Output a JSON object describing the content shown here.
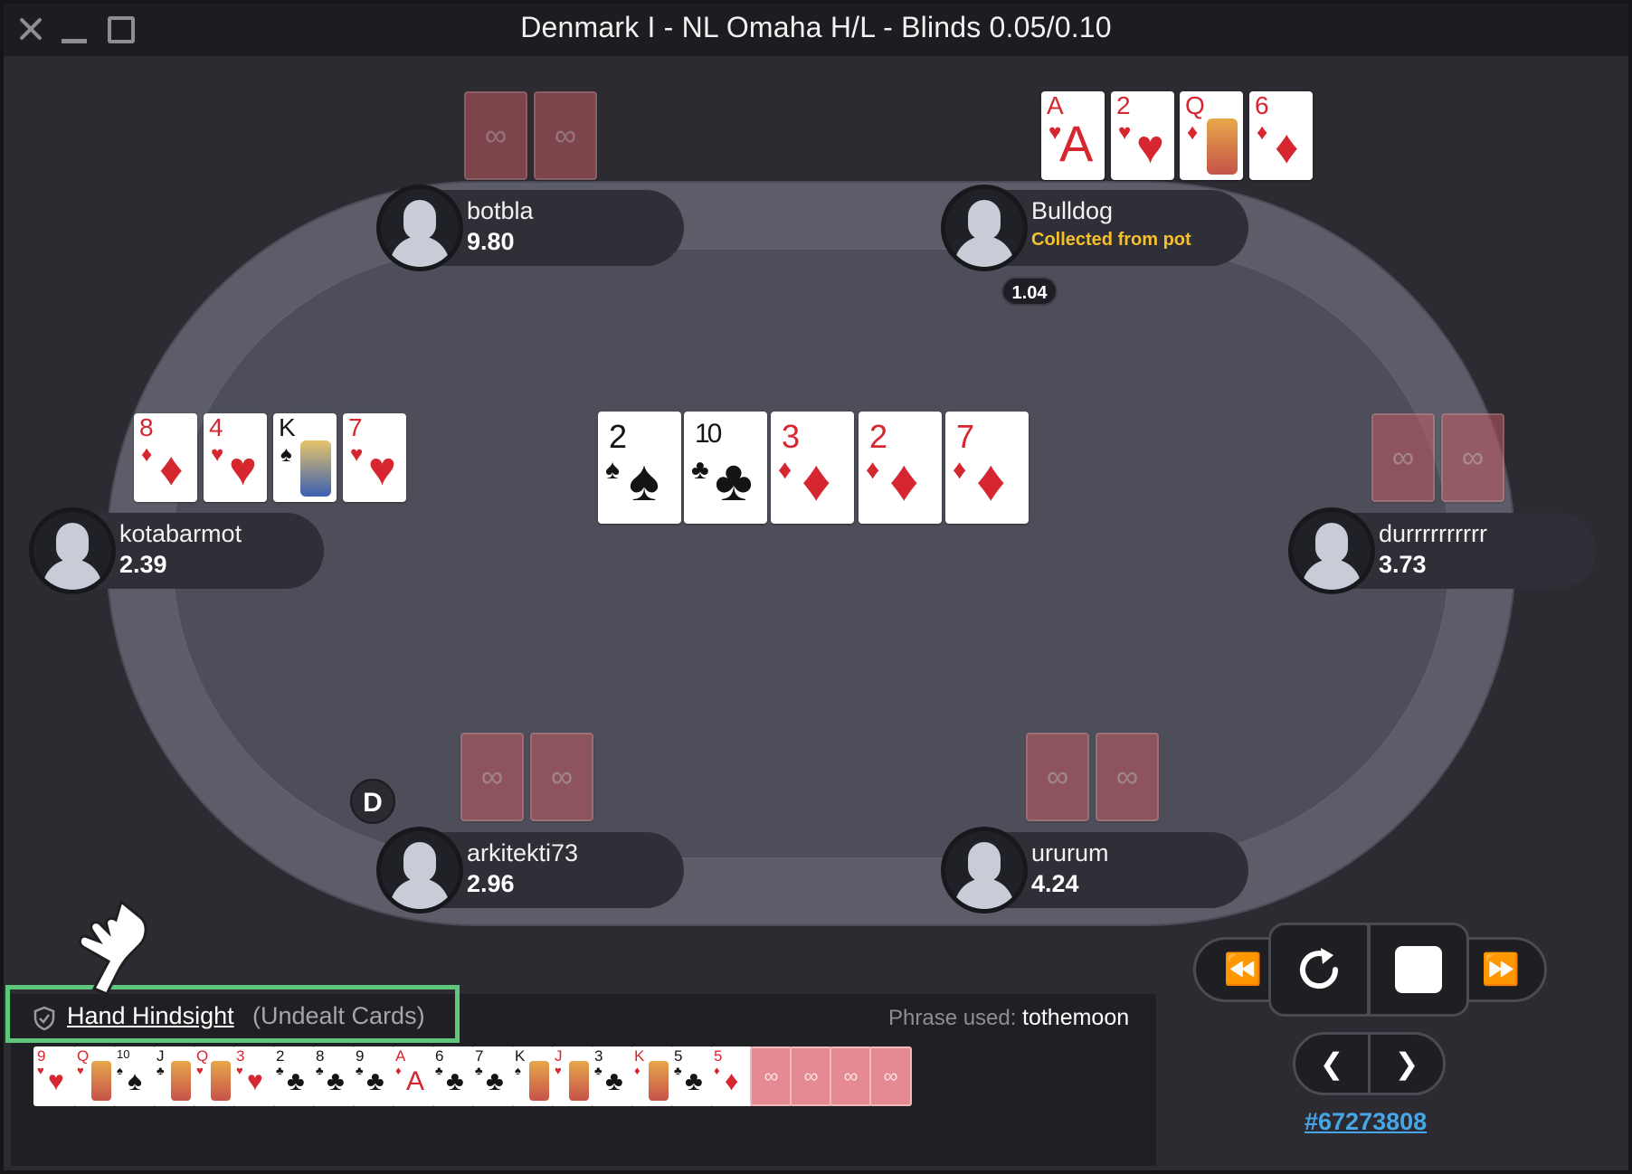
{
  "window": {
    "title": "Denmark I - NL Omaha H/L - Blinds 0.05/0.10"
  },
  "colors": {
    "status": "#f6bf2c",
    "highlight": "#5fc77c",
    "link": "#46a6e8",
    "card_red": "#d6262f",
    "card_back": "#c25a62"
  },
  "players": [
    {
      "name": "botbla",
      "stack": "9.80",
      "cards": "hidden"
    },
    {
      "name": "Bulldog",
      "status": "Collected from pot",
      "cards": [
        {
          "rank": "A",
          "suit": "♥"
        },
        {
          "rank": "2",
          "suit": "♥"
        },
        {
          "rank": "Q",
          "suit": "♦"
        },
        {
          "rank": "6",
          "suit": "♦"
        }
      ]
    },
    {
      "name": "kotabarmot",
      "stack": "2.39",
      "cards": [
        {
          "rank": "8",
          "suit": "♦"
        },
        {
          "rank": "4",
          "suit": "♥"
        },
        {
          "rank": "K",
          "suit": "♠"
        },
        {
          "rank": "7",
          "suit": "♥"
        }
      ]
    },
    {
      "name": "durrrrrrrrrr",
      "stack": "3.73",
      "cards": "hidden"
    },
    {
      "name": "arkitekti73",
      "stack": "2.96",
      "cards": "hidden"
    },
    {
      "name": "ururum",
      "stack": "4.24",
      "cards": "hidden"
    }
  ],
  "pot_chip": "1.04",
  "dealer_button": "D",
  "board": [
    {
      "rank": "2",
      "suit": "♠"
    },
    {
      "rank": "10",
      "suit": "♣"
    },
    {
      "rank": "3",
      "suit": "♦"
    },
    {
      "rank": "2",
      "suit": "♦"
    },
    {
      "rank": "7",
      "suit": "♦"
    }
  ],
  "hindsight": {
    "link": "Hand Hindsight",
    "subtitle": "(Undealt Cards)",
    "phrase_label": "Phrase used:",
    "phrase_value": "tothemoon",
    "undealt_cards": [
      {
        "rank": "9",
        "suit": "♥"
      },
      {
        "rank": "Q",
        "suit": "♥"
      },
      {
        "rank": "10",
        "suit": "♠"
      },
      {
        "rank": "J",
        "suit": "♣"
      },
      {
        "rank": "Q",
        "suit": "♥"
      },
      {
        "rank": "3",
        "suit": "♥"
      },
      {
        "rank": "2",
        "suit": "♣"
      },
      {
        "rank": "8",
        "suit": "♣"
      },
      {
        "rank": "9",
        "suit": "♣"
      },
      {
        "rank": "A",
        "suit": "♦"
      },
      {
        "rank": "6",
        "suit": "♣"
      },
      {
        "rank": "7",
        "suit": "♣"
      },
      {
        "rank": "K",
        "suit": "♠"
      },
      {
        "rank": "J",
        "suit": "♥"
      },
      {
        "rank": "3",
        "suit": "♣"
      },
      {
        "rank": "K",
        "suit": "♦"
      },
      {
        "rank": "5",
        "suit": "♣"
      },
      {
        "rank": "5",
        "suit": "♦"
      }
    ],
    "hidden_count": 4
  },
  "controls": {
    "rewind_icon": "double-left-arrow",
    "replay_icon": "circular-arrow",
    "stop_icon": "square",
    "forward_icon": "double-right-arrow",
    "prev_icon": "chevron-left",
    "next_icon": "chevron-right",
    "hand_id": "#67273808"
  }
}
